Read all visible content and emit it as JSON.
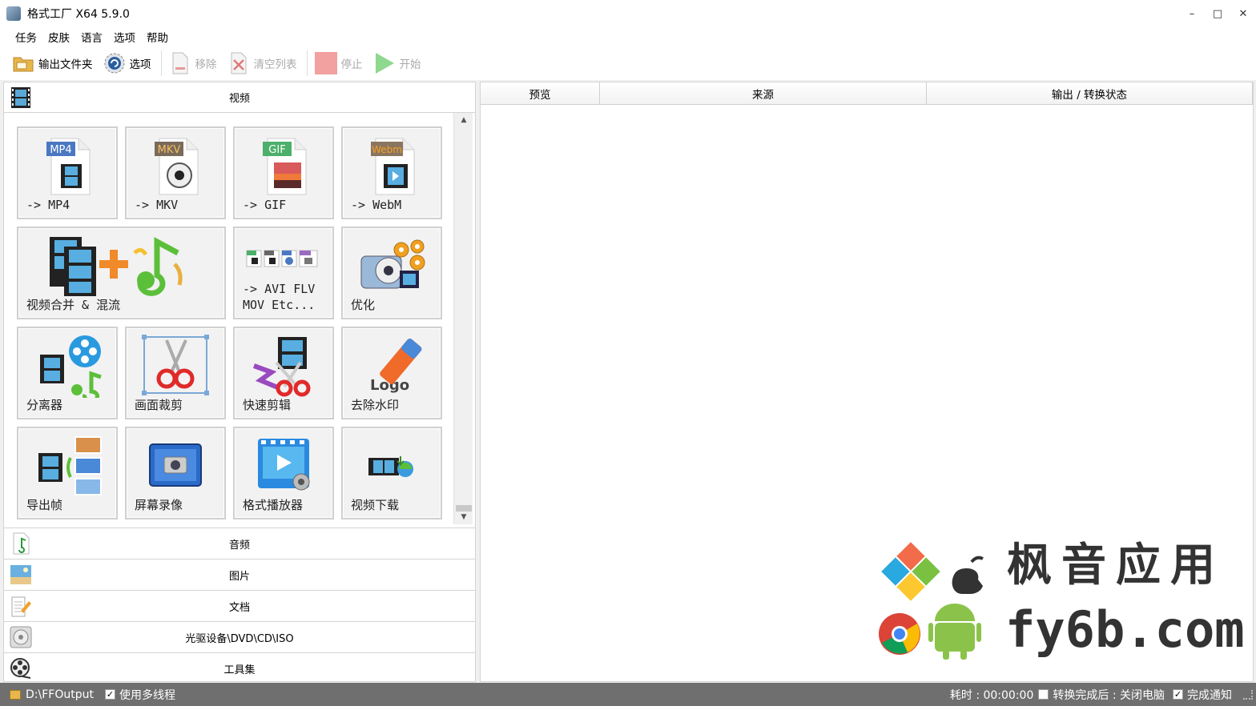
{
  "window": {
    "title": "格式工厂 X64 5.9.0",
    "minimize": "–",
    "maximize": "□",
    "close": "✕"
  },
  "menu": [
    "任务",
    "皮肤",
    "语言",
    "选项",
    "帮助"
  ],
  "toolbar": {
    "output_folder": "输出文件夹",
    "options": "选项",
    "remove": "移除",
    "clear_list": "清空列表",
    "stop": "停止",
    "start": "开始"
  },
  "video_category": {
    "label": "视频"
  },
  "tiles": [
    {
      "label": "-> MP4",
      "icon": "mp4-file-icon",
      "badge": "MP4"
    },
    {
      "label": "-> MKV",
      "icon": "mkv-file-icon",
      "badge": "MKV"
    },
    {
      "label": "-> GIF",
      "icon": "gif-file-icon",
      "badge": "GIF"
    },
    {
      "label": "-> WebM",
      "icon": "webm-file-icon",
      "badge": "Webm"
    },
    {
      "label": "视频合并 & 混流",
      "icon": "merge-mux-icon"
    },
    {
      "label": "-> AVI FLV",
      "label2": "MOV Etc...",
      "icon": "other-formats-icon"
    },
    {
      "label": "优化",
      "icon": "optimize-gears-icon"
    },
    {
      "label": "分离器",
      "icon": "splitter-icon"
    },
    {
      "label": "画面裁剪",
      "icon": "crop-scissors-icon"
    },
    {
      "label": "快速剪辑",
      "icon": "quick-clip-icon"
    },
    {
      "label": "去除水印",
      "icon": "remove-watermark-icon",
      "logo_text": "Logo"
    },
    {
      "label": "导出帧",
      "icon": "export-frames-icon"
    },
    {
      "label": "屏幕录像",
      "icon": "screen-record-icon"
    },
    {
      "label": "格式播放器",
      "icon": "player-icon"
    },
    {
      "label": "视频下载",
      "icon": "video-download-icon"
    }
  ],
  "categories": [
    {
      "label": "音频",
      "icon": "music-note-icon"
    },
    {
      "label": "图片",
      "icon": "picture-icon"
    },
    {
      "label": "文档",
      "icon": "document-icon"
    },
    {
      "label": "光驱设备\\DVD\\CD\\ISO",
      "icon": "disc-icon"
    },
    {
      "label": "工具集",
      "icon": "toolbox-icon"
    }
  ],
  "table": {
    "columns": [
      "预览",
      "来源",
      "输出 / 转换状态"
    ]
  },
  "status": {
    "output_path": "D:\\FFOutput",
    "multithread_label": "使用多线程",
    "multithread_checked": true,
    "elapsed": "耗时 : 00:00:00",
    "after_convert_label": "转换完成后 : 关闭电脑",
    "after_convert_checked": false,
    "notify_label": "完成通知",
    "notify_checked": true
  },
  "watermark": {
    "brand": "枫音应用",
    "domain": "fy6b.com"
  },
  "colors": {
    "status_bg": "#6f6f6f",
    "start_green": "#8fd88f",
    "stop_red": "#f2a0a0"
  }
}
